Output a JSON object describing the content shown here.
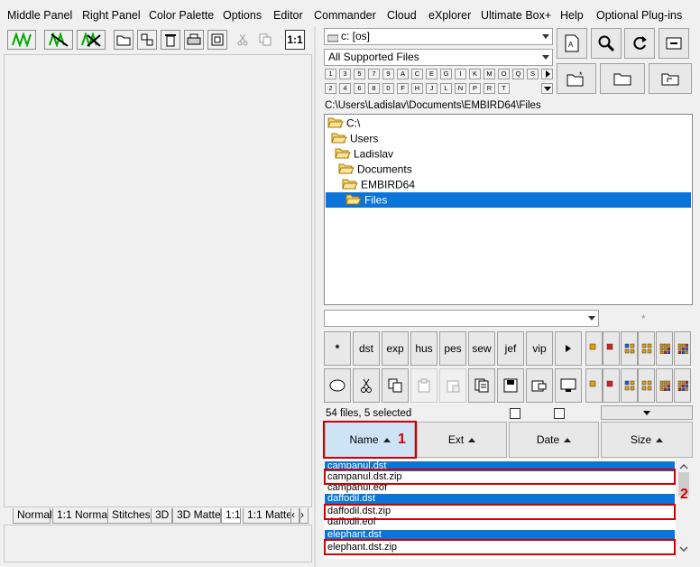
{
  "menu": [
    "Middle Panel",
    "Right Panel",
    "Color Palette",
    "Options",
    "Editor",
    "Commander",
    "Cloud",
    "eXplorer",
    "Ultimate Box+",
    "Help",
    "Optional Plug-ins"
  ],
  "left_toolbar": {
    "icons": [
      "stitch-view-icon",
      "stitch-crossed-icon",
      "stitch-xx-icon",
      "open-folder-icon",
      "export-icon",
      "trash-icon",
      "print-icon",
      "frame-icon",
      "cut-icon",
      "copy-icon"
    ],
    "zoom_label": "1:1"
  },
  "view_tabs": [
    "Normal",
    "1:1 Normal",
    "Stitches",
    "3D",
    "3D Matte",
    "1:1",
    "1:1 Matte"
  ],
  "drive_combo": "c: [os]",
  "filter_combo": "All Supported Files",
  "key_row1": [
    "1",
    "3",
    "5",
    "7",
    "9",
    "A",
    "C",
    "E",
    "G",
    "I",
    "K",
    "M",
    "O",
    "Q",
    "S"
  ],
  "key_row2": [
    "2",
    "4",
    "6",
    "8",
    "0",
    "F",
    "H",
    "J",
    "L",
    "N",
    "P",
    "R",
    "T"
  ],
  "path": "C:\\Users\\Ladislav\\Documents\\EMBIRD64\\Files",
  "tree": [
    {
      "label": "C:\\",
      "indent": 0,
      "open": true,
      "selected": false
    },
    {
      "label": "Users",
      "indent": 1,
      "open": true,
      "selected": false
    },
    {
      "label": "Ladislav",
      "indent": 2,
      "open": true,
      "selected": false
    },
    {
      "label": "Documents",
      "indent": 3,
      "open": true,
      "selected": false
    },
    {
      "label": "EMBIRD64",
      "indent": 4,
      "open": true,
      "selected": false
    },
    {
      "label": "Files",
      "indent": 5,
      "open": true,
      "selected": true
    }
  ],
  "asterisk_label": "*",
  "ext_buttons": [
    "*",
    "dst",
    "exp",
    "hus",
    "pes",
    "sew",
    "jef",
    "vip"
  ],
  "status_text": "54 files, 5 selected",
  "sort_headers": {
    "name": "Name",
    "ext": "Ext",
    "date": "Date",
    "size": "Size"
  },
  "annotations": [
    "1",
    "2"
  ],
  "files": [
    {
      "name": "campanul.dst",
      "selected": true
    },
    {
      "name": "campanul.dst.zip",
      "selected": false
    },
    {
      "name": "campanul.eof",
      "selected": false
    },
    {
      "name": "daffodil.dst",
      "selected": true
    },
    {
      "name": "daffodil.dst.zip",
      "selected": false
    },
    {
      "name": "daffodil.eof",
      "selected": false
    },
    {
      "name": "elephant.dst",
      "selected": true
    },
    {
      "name": "elephant.dst.zip",
      "selected": false
    }
  ],
  "colors": {
    "selection": "#0a74d8",
    "annotation": "#d40000",
    "header_active": "#cfe3f7"
  }
}
